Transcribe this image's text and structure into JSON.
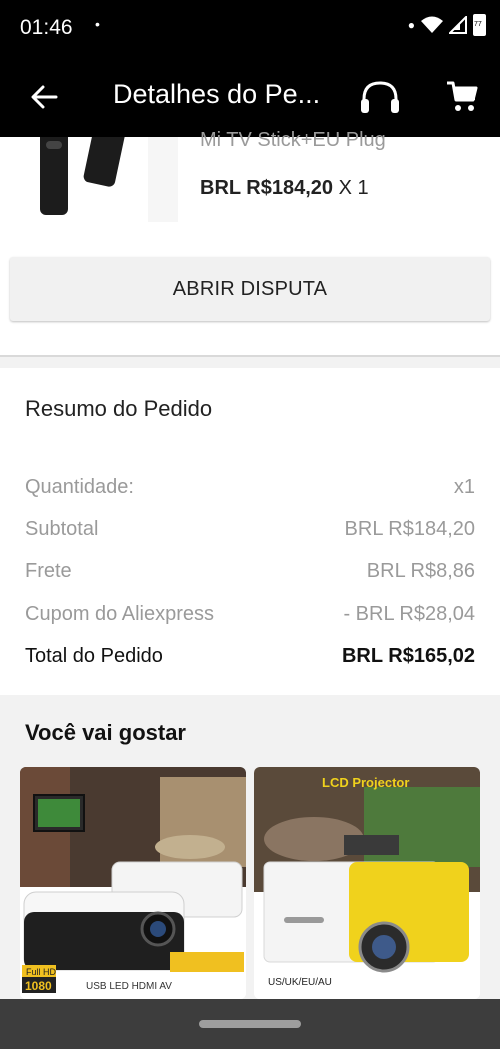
{
  "status": {
    "time": "01:46",
    "dot": "•",
    "battery": "77"
  },
  "appbar": {
    "title": "Detalhes do Pe..."
  },
  "product": {
    "name": "Mi TV Stick+EU Plug",
    "price": "BRL R$184,20",
    "qty": "X 1",
    "dispute_label": "ABRIR DISPUTA"
  },
  "summary": {
    "title": "Resumo do Pedido",
    "rows": [
      {
        "label": "Quantidade:",
        "value": "x1"
      },
      {
        "label": "Subtotal",
        "value": "BRL R$184,20"
      },
      {
        "label": "Frete",
        "value": "BRL R$8,86"
      },
      {
        "label": "Cupom do Aliexpress",
        "value": "- BRL R$28,04"
      },
      {
        "label": "Total do Pedido",
        "value": "BRL R$165,02"
      }
    ]
  },
  "recs": {
    "title": "Você vai gostar",
    "card1": {
      "badge_top": "Full HD",
      "badge_bottom": "1080",
      "features": "USB  LED  HDMI  AV"
    },
    "card2": {
      "tag": "LCD Projector",
      "regions": "US/UK/EU/AU"
    }
  },
  "colors": {
    "accent_yellow": "#f0d21c",
    "status_bg": "#000000"
  }
}
